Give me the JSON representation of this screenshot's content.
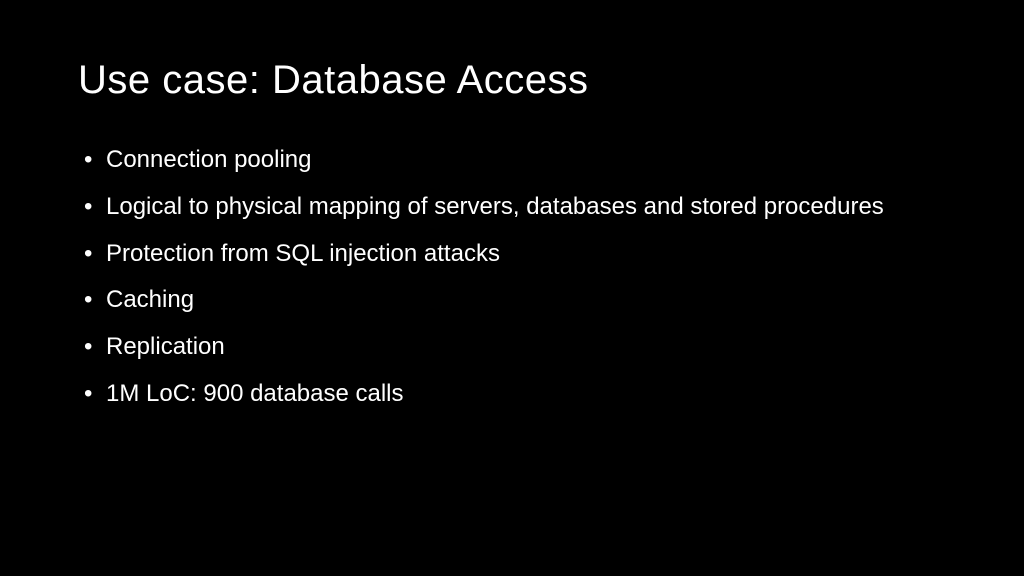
{
  "slide": {
    "title": "Use case: Database Access",
    "bullets": [
      "Connection pooling",
      "Logical to physical mapping of servers, databases and stored procedures",
      "Protection from SQL injection attacks",
      "Caching",
      "Replication",
      "1M LoC: 900 database calls"
    ]
  }
}
